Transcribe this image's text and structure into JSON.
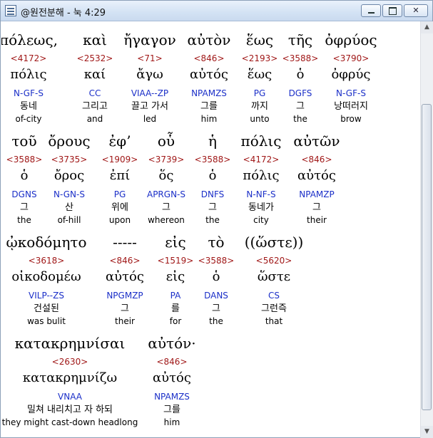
{
  "window": {
    "title": "@원전분해 - 눅 4:29",
    "min_glyph": "",
    "max_glyph": "",
    "close_glyph": ""
  },
  "icons": {
    "scroll_up": "▲",
    "scroll_down": "▼"
  },
  "rows": [
    [
      {
        "gk": "πόλεως,",
        "num": "<4172>",
        "lem": "πόλις",
        "par": "N-GF-S",
        "ko": "동네",
        "en": "of-city"
      },
      {
        "gk": "καὶ",
        "num": "<2532>",
        "lem": "καί",
        "par": "CC",
        "ko": "그리고",
        "en": "and"
      },
      {
        "gk": "ἤγαγον",
        "num": "<71>",
        "lem": "ἄγω",
        "par": "VIAA--ZP",
        "ko": "끌고 가서",
        "en": "led"
      },
      {
        "gk": "αὐτὸν",
        "num": "<846>",
        "lem": "αὐτός",
        "par": "NPAMZS",
        "ko": "그를",
        "en": "him"
      },
      {
        "gk": "ἕως",
        "num": "<2193>",
        "lem": "ἕως",
        "par": "PG",
        "ko": "까지",
        "en": "unto"
      },
      {
        "gk": "τῆς",
        "num": "<3588>",
        "lem": "ὁ",
        "par": "DGFS",
        "ko": "그",
        "en": "the"
      },
      {
        "gk": "ὀφρύος",
        "num": "<3790>",
        "lem": "ὀφρύς",
        "par": "N-GF-S",
        "ko": "낭떠러지",
        "en": "brow"
      }
    ],
    [
      {
        "gk": "τοῦ",
        "num": "<3588>",
        "lem": "ὁ",
        "par": "DGNS",
        "ko": "그",
        "en": "the"
      },
      {
        "gk": "ὄρους",
        "num": "<3735>",
        "lem": "ὄρος",
        "par": "N-GN-S",
        "ko": "산",
        "en": "of-hill"
      },
      {
        "gk": "ἐφ’",
        "num": "<1909>",
        "lem": "ἐπί",
        "par": "PG",
        "ko": "위에",
        "en": "upon"
      },
      {
        "gk": "οὗ",
        "num": "<3739>",
        "lem": "ὅς",
        "par": "APRGN-S",
        "ko": "그",
        "en": "whereon"
      },
      {
        "gk": "ἡ",
        "num": "<3588>",
        "lem": "ὁ",
        "par": "DNFS",
        "ko": "그",
        "en": "the"
      },
      {
        "gk": "πόλις",
        "num": "<4172>",
        "lem": "πόλις",
        "par": "N-NF-S",
        "ko": "동네가",
        "en": "city"
      },
      {
        "gk": "αὐτῶν",
        "num": "<846>",
        "lem": "αὐτός",
        "par": "NPAMZP",
        "ko": "그",
        "en": "their"
      }
    ],
    [
      {
        "gk": "ᾠκοδόμητο",
        "num": "<3618>",
        "lem": "οἰκοδομέω",
        "par": "VILP--ZS",
        "ko": "건설된",
        "en": "was bulit"
      },
      {
        "gk": "-----",
        "num": "<846>",
        "lem": "αὐτός",
        "par": "NPGMZP",
        "ko": "그",
        "en": "their"
      },
      {
        "gk": "εἰς",
        "num": "<1519>",
        "lem": "εἰς",
        "par": "PA",
        "ko": "를",
        "en": "for"
      },
      {
        "gk": "τὸ",
        "num": "<3588>",
        "lem": "ὁ",
        "par": "DANS",
        "ko": "그",
        "en": "the"
      },
      {
        "gk": "((ὥστε))",
        "num": "<5620>",
        "lem": "ὥστε",
        "par": "CS",
        "ko": "그런즉",
        "en": "that"
      }
    ],
    [
      {
        "gk": "κατακρημνίσαι",
        "num": "<2630>",
        "lem": "κατακρημνίζω",
        "par": "VNAA",
        "ko": "밀쳐 내리치고 자 하되",
        "en": "they might cast-down headlong"
      },
      {
        "gk": "αὐτόν·",
        "num": "<846>",
        "lem": "αὐτός",
        "par": "NPAMZS",
        "ko": "그를",
        "en": "him"
      }
    ]
  ]
}
